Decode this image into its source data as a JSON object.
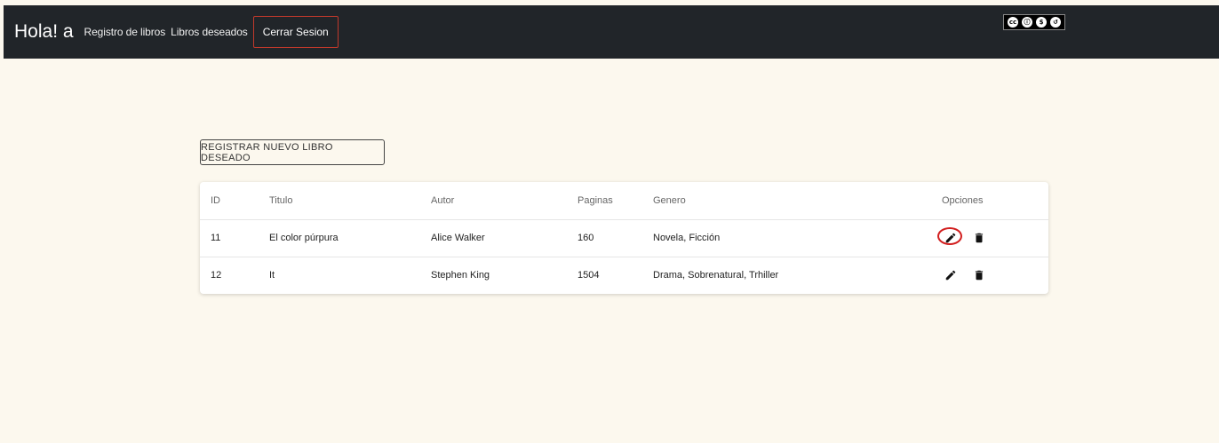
{
  "navbar": {
    "brand": "Hola! a",
    "links": [
      "Registro de libros",
      "Libros deseados"
    ],
    "logout_label": "Cerrar Sesion",
    "background": "#212529",
    "license_badge": {
      "icons": [
        "creative-commons-icon",
        "by-icon",
        "nc-icon",
        "sa-icon"
      ]
    }
  },
  "main": {
    "new_button_label": "REGISTRAR NUEVO LIBRO DESEADO",
    "table": {
      "headers": [
        "ID",
        "Titulo",
        "Autor",
        "Paginas",
        "Genero",
        "Opciones"
      ],
      "rows": [
        [
          "11",
          "El color púrpura",
          "Alice Walker",
          "160",
          "Novela, Ficción"
        ],
        [
          "12",
          "It",
          "Stephen King",
          "1504",
          "Drama, Sobrenatural, Trhiller"
        ]
      ],
      "row_actions": [
        "edit-icon",
        "delete-icon"
      ],
      "highlight_color": "#d21f1f"
    },
    "page_background": "#fcf8ee"
  }
}
